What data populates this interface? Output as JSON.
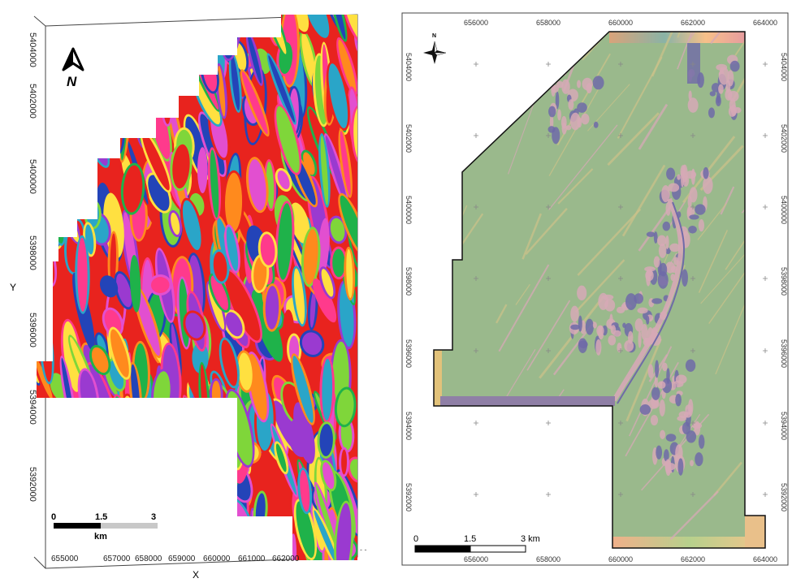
{
  "left_map": {
    "north_label": "N",
    "x_axis_label": "X",
    "y_axis_label": "Y",
    "x_ticks": [
      "655000",
      "657000",
      "658000",
      "659000",
      "660000",
      "661000",
      "662000"
    ],
    "y_ticks": [
      "5404000",
      "5402000",
      "5400000",
      "5398000",
      "5396000",
      "5394000",
      "5392000"
    ],
    "scale_labels": [
      "0",
      "1.5",
      "3"
    ],
    "scale_unit": "km",
    "palette": [
      "#e8231e",
      "#ff8a1d",
      "#ffe040",
      "#7fd63a",
      "#1fb24a",
      "#2aa5c8",
      "#2344b8",
      "#9a3ad0",
      "#e24fd0",
      "#ff3a8c"
    ],
    "corner_marks": "- -"
  },
  "right_map": {
    "north_label": "N",
    "x_ticks_top": [
      "656000",
      "658000",
      "660000",
      "662000",
      "664000"
    ],
    "x_ticks_bottom": [
      "656000",
      "658000",
      "660000",
      "662000",
      "664000"
    ],
    "y_ticks_left": [
      "5404000",
      "5402000",
      "5400000",
      "5398000",
      "5396000",
      "5394000",
      "5392000"
    ],
    "y_ticks_right": [
      "5404000",
      "5402000",
      "5400000",
      "5398000",
      "5396000",
      "5394000",
      "5392000"
    ],
    "scale_labels": [
      "0",
      "1.5",
      "3 km"
    ],
    "base_color": "#9ab98c",
    "ridge_color": "#d6a9b6",
    "trough_color": "#6f6aa8",
    "strip_color": "#8f7fa6"
  }
}
